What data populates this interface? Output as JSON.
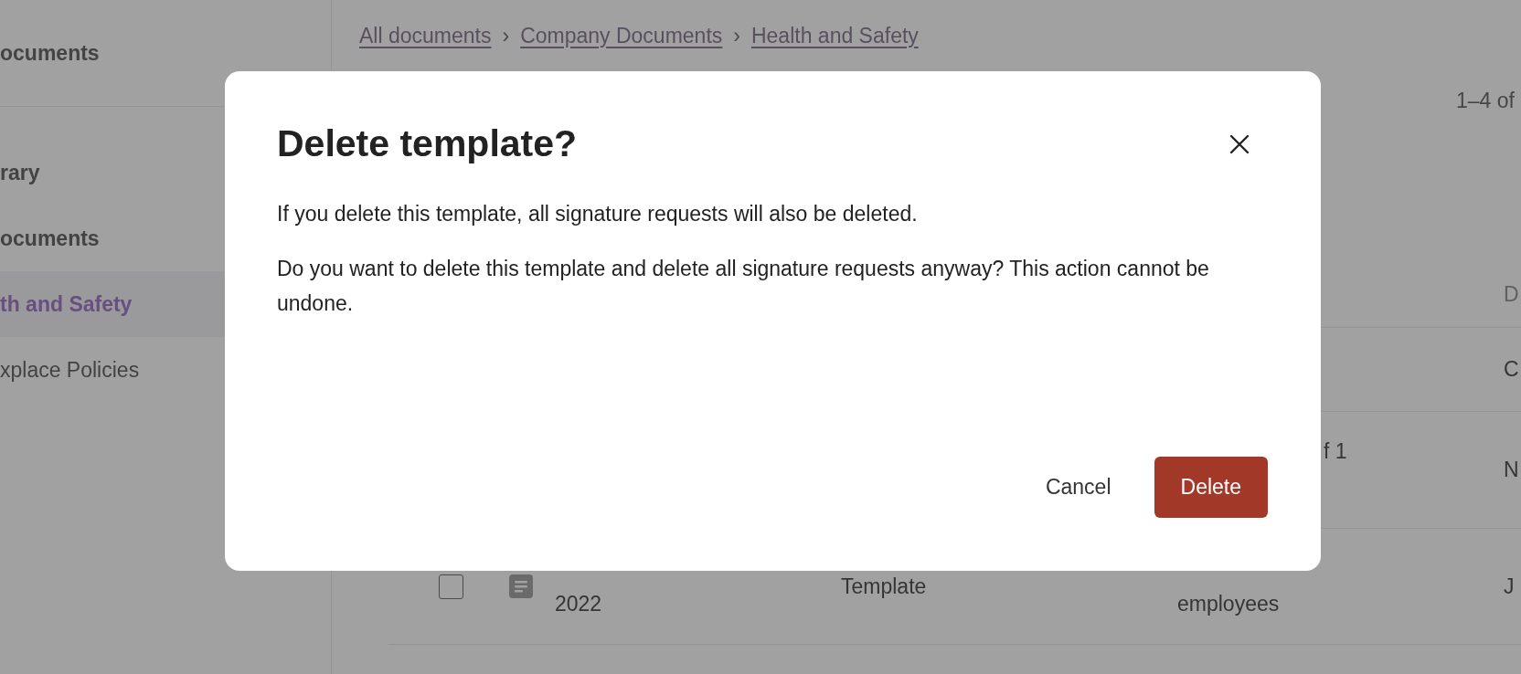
{
  "sidebar": {
    "header": "ocuments",
    "items": [
      {
        "label": "rary",
        "selected": false
      },
      {
        "label": "ocuments",
        "selected": false
      },
      {
        "label": "th and Safety",
        "selected": true
      },
      {
        "label": "xplace Policies",
        "selected": false
      }
    ]
  },
  "breadcrumbs": {
    "separator": "›",
    "items": [
      "All documents",
      "Company Documents",
      "Health and Safety"
    ]
  },
  "pager": "1–4 of",
  "table": {
    "columns": [
      {
        "label": "D"
      }
    ],
    "rows": [
      {
        "date": "C"
      },
      {
        "status": "f 1",
        "date": "N"
      },
      {
        "kind": "document",
        "checked": false,
        "name": "2022",
        "type": "Template",
        "status": "employees",
        "date": "J"
      }
    ]
  },
  "dialog": {
    "title": "Delete template?",
    "paragraphs": [
      "If you delete this template, all signature requests will also be deleted.",
      "Do you want to delete this template and delete all signature requests anyway? This action cannot be undone."
    ],
    "buttons": [
      {
        "label": "Cancel",
        "kind": "secondary"
      },
      {
        "label": "Delete",
        "kind": "danger"
      }
    ]
  }
}
